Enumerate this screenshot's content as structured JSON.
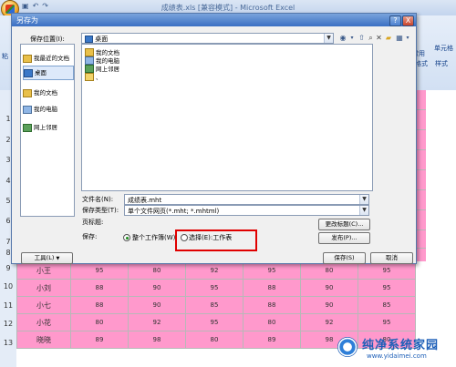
{
  "app": {
    "title": "成绩表.xls [兼容模式] - Microsoft Excel",
    "qat_icons": [
      "save-icon",
      "undo-icon",
      "redo-icon"
    ],
    "ribbon_labels": [
      "粘",
      "常用",
      "单元格",
      "格式",
      "样式",
      "式"
    ]
  },
  "rows": [
    "1",
    "2",
    "3",
    "4",
    "5",
    "6",
    "7",
    "8",
    "9",
    "10",
    "11",
    "12",
    "13"
  ],
  "table": [
    {
      "row": "9",
      "name": "小王",
      "values": [
        "95",
        "80",
        "92",
        "95",
        "80",
        "95"
      ]
    },
    {
      "row": "10",
      "name": "小刘",
      "values": [
        "88",
        "90",
        "95",
        "88",
        "90",
        "95"
      ]
    },
    {
      "row": "11",
      "name": "小七",
      "values": [
        "88",
        "90",
        "85",
        "88",
        "90",
        "85"
      ]
    },
    {
      "row": "12",
      "name": "小花",
      "values": [
        "80",
        "92",
        "95",
        "80",
        "92",
        "95"
      ]
    },
    {
      "row": "13",
      "name": "晓晓",
      "values": [
        "89",
        "98",
        "80",
        "89",
        "98",
        "80"
      ]
    }
  ],
  "dialog": {
    "title": "另存为",
    "help_label": "?",
    "close_label": "X",
    "save_in_label": "保存位置(I):",
    "save_in_value": "桌面",
    "places": [
      {
        "label": "我最近的文档",
        "icon": "recent-documents-icon"
      },
      {
        "label": "桌面",
        "icon": "desktop-icon"
      },
      {
        "label": "我的文档",
        "icon": "my-documents-icon"
      },
      {
        "label": "我的电脑",
        "icon": "my-computer-icon"
      },
      {
        "label": "网上邻居",
        "icon": "network-places-icon"
      }
    ],
    "files": [
      {
        "label": "我的文档",
        "icon": "folder-icon"
      },
      {
        "label": "我的电脑",
        "icon": "computer-icon"
      },
      {
        "label": "网上邻居",
        "icon": "network-icon"
      },
      {
        "label": "、",
        "icon": "folder-icon"
      }
    ],
    "filename_label": "文件名(N):",
    "filename_value": "成绩表.mht",
    "filetype_label": "保存类型(T):",
    "filetype_value": "单个文件网页(*.mht; *.mhtml)",
    "page_title_label": "页标题:",
    "change_title_label": "更改标题(C)...",
    "save_scope_label": "保存:",
    "radio_whole_workbook": "整个工作簿(W)",
    "radio_selection": "选择(E):工作表",
    "publish_label": "发布(P)...",
    "tools_label": "工具(L)",
    "save_label": "保存(S)",
    "cancel_label": "取消"
  },
  "watermark": {
    "text": "纯净系统家园",
    "url": "www.yidaimei.com"
  },
  "colors": {
    "cell_highlight": "#ff99cc",
    "annotation_box": "#e00000",
    "dialog_titlebar": "#3b6fc3"
  }
}
